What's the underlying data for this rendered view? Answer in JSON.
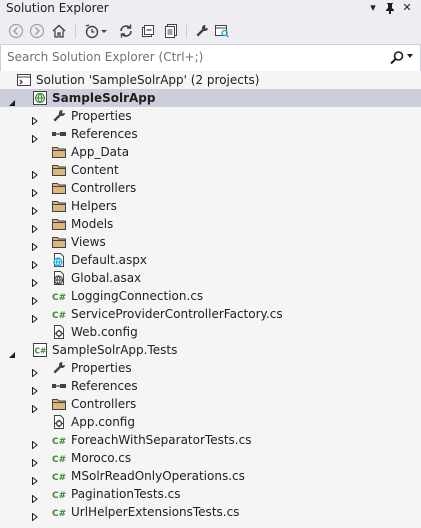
{
  "window": {
    "title": "Solution Explorer",
    "pin_glyph": "▾",
    "autohide_glyph": "⚲",
    "close_glyph": "✕"
  },
  "search": {
    "placeholder": "Search Solution Explorer (Ctrl+;)"
  },
  "colors": {
    "folder": "#dcb67a",
    "csharp": "#388a34",
    "selection": "#cccedb",
    "wrench": "#424242"
  },
  "tree": [
    {
      "label": "Solution 'SampleSolrApp' (2 projects)",
      "icon": "solution-icon",
      "level": 0,
      "expander": "none",
      "bold": false,
      "selected": false
    },
    {
      "label": "SampleSolrApp",
      "icon": "web-project-icon",
      "level": 0,
      "expander": "expanded",
      "bold": true,
      "selected": true
    },
    {
      "label": "Properties",
      "icon": "wrench-icon",
      "level": 1,
      "expander": "collapsed",
      "bold": false,
      "selected": false
    },
    {
      "label": "References",
      "icon": "references-icon",
      "level": 1,
      "expander": "collapsed",
      "bold": false,
      "selected": false
    },
    {
      "label": "App_Data",
      "icon": "folder-icon",
      "level": 1,
      "expander": "none",
      "bold": false,
      "selected": false
    },
    {
      "label": "Content",
      "icon": "folder-icon",
      "level": 1,
      "expander": "collapsed",
      "bold": false,
      "selected": false
    },
    {
      "label": "Controllers",
      "icon": "folder-icon",
      "level": 1,
      "expander": "collapsed",
      "bold": false,
      "selected": false
    },
    {
      "label": "Helpers",
      "icon": "folder-icon",
      "level": 1,
      "expander": "collapsed",
      "bold": false,
      "selected": false
    },
    {
      "label": "Models",
      "icon": "folder-icon",
      "level": 1,
      "expander": "collapsed",
      "bold": false,
      "selected": false
    },
    {
      "label": "Views",
      "icon": "folder-icon",
      "level": 1,
      "expander": "collapsed",
      "bold": false,
      "selected": false
    },
    {
      "label": "Default.aspx",
      "icon": "aspx-file-icon",
      "level": 1,
      "expander": "collapsed",
      "bold": false,
      "selected": false
    },
    {
      "label": "Global.asax",
      "icon": "asax-file-icon",
      "level": 1,
      "expander": "collapsed",
      "bold": false,
      "selected": false
    },
    {
      "label": "LoggingConnection.cs",
      "icon": "csharp-file-icon",
      "level": 1,
      "expander": "collapsed",
      "bold": false,
      "selected": false
    },
    {
      "label": "ServiceProviderControllerFactory.cs",
      "icon": "csharp-file-icon",
      "level": 1,
      "expander": "collapsed",
      "bold": false,
      "selected": false
    },
    {
      "label": "Web.config",
      "icon": "config-file-icon",
      "level": 1,
      "expander": "none",
      "bold": false,
      "selected": false
    },
    {
      "label": "SampleSolrApp.Tests",
      "icon": "csharp-project-icon",
      "level": 0,
      "expander": "expanded",
      "bold": false,
      "selected": false
    },
    {
      "label": "Properties",
      "icon": "wrench-icon",
      "level": 1,
      "expander": "collapsed",
      "bold": false,
      "selected": false
    },
    {
      "label": "References",
      "icon": "references-icon",
      "level": 1,
      "expander": "collapsed",
      "bold": false,
      "selected": false
    },
    {
      "label": "Controllers",
      "icon": "folder-icon",
      "level": 1,
      "expander": "collapsed",
      "bold": false,
      "selected": false
    },
    {
      "label": "App.config",
      "icon": "config-file-icon",
      "level": 1,
      "expander": "none",
      "bold": false,
      "selected": false
    },
    {
      "label": "ForeachWithSeparatorTests.cs",
      "icon": "csharp-file-icon",
      "level": 1,
      "expander": "collapsed",
      "bold": false,
      "selected": false
    },
    {
      "label": "Moroco.cs",
      "icon": "csharp-file-icon",
      "level": 1,
      "expander": "collapsed",
      "bold": false,
      "selected": false
    },
    {
      "label": "MSolrReadOnlyOperations.cs",
      "icon": "csharp-file-icon",
      "level": 1,
      "expander": "collapsed",
      "bold": false,
      "selected": false
    },
    {
      "label": "PaginationTests.cs",
      "icon": "csharp-file-icon",
      "level": 1,
      "expander": "collapsed",
      "bold": false,
      "selected": false
    },
    {
      "label": "UrlHelperExtensionsTests.cs",
      "icon": "csharp-file-icon",
      "level": 1,
      "expander": "collapsed",
      "bold": false,
      "selected": false
    }
  ]
}
